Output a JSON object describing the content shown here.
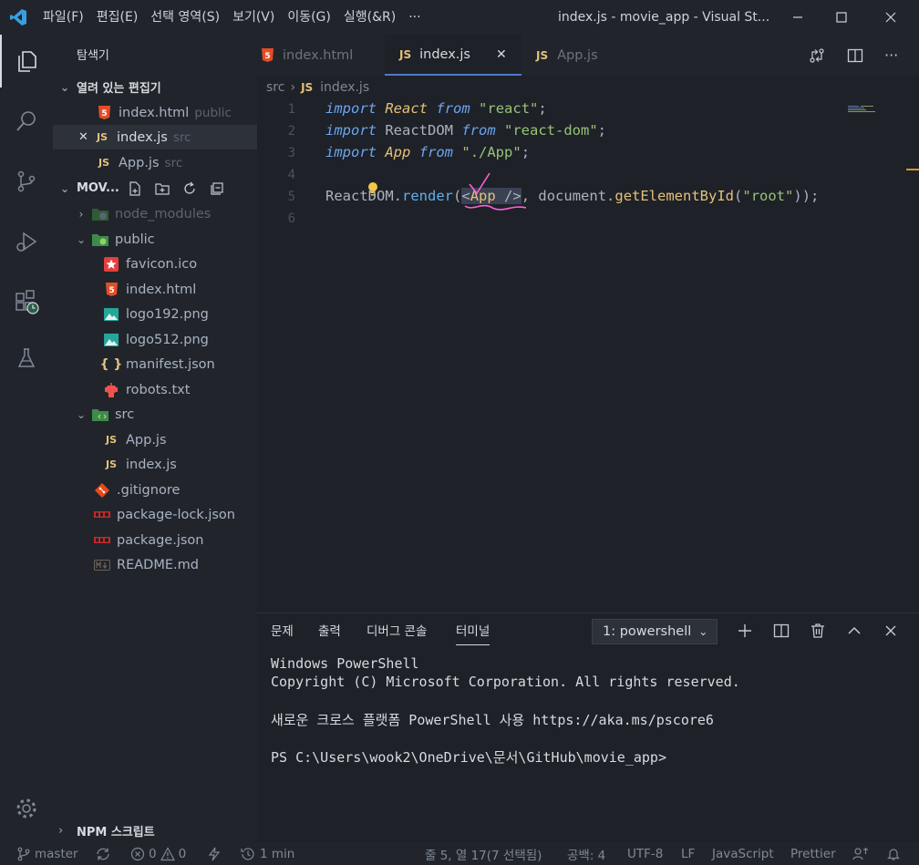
{
  "window": {
    "title": "index.js - movie_app - Visual St...",
    "menu": [
      "파일(F)",
      "편집(E)",
      "선택 영역(S)",
      "보기(V)",
      "이동(G)",
      "실행(&R)",
      "···"
    ]
  },
  "sidebar": {
    "title": "탐색기",
    "open_editors_header": "열려 있는 편집기",
    "open_editors": [
      {
        "name": "index.html",
        "dir": "public",
        "icon": "html5-icon"
      },
      {
        "name": "index.js",
        "dir": "src",
        "icon": "js-icon"
      },
      {
        "name": "App.js",
        "dir": "src",
        "icon": "js-icon"
      }
    ],
    "project_header": "MOV...",
    "tree": [
      {
        "name": "node_modules",
        "icon": "folder-node-icon"
      },
      {
        "name": "public",
        "icon": "folder-public-icon"
      },
      {
        "name": "favicon.ico",
        "icon": "star-icon"
      },
      {
        "name": "index.html",
        "icon": "html5-icon"
      },
      {
        "name": "logo192.png",
        "icon": "image-icon"
      },
      {
        "name": "logo512.png",
        "icon": "image-icon"
      },
      {
        "name": "manifest.json",
        "icon": "json-icon"
      },
      {
        "name": "robots.txt",
        "icon": "robot-icon"
      },
      {
        "name": "src",
        "icon": "folder-src-icon"
      },
      {
        "name": "App.js",
        "icon": "js-icon"
      },
      {
        "name": "index.js",
        "icon": "js-icon"
      },
      {
        "name": ".gitignore",
        "icon": "git-icon"
      },
      {
        "name": "package-lock.json",
        "icon": "npm-icon"
      },
      {
        "name": "package.json",
        "icon": "npm-icon"
      },
      {
        "name": "README.md",
        "icon": "markdown-icon"
      }
    ],
    "npm_header": "NPM 스크립트"
  },
  "tabs": [
    {
      "label": "index.html",
      "icon": "html5-icon"
    },
    {
      "label": "index.js",
      "icon": "js-icon"
    },
    {
      "label": "App.js",
      "icon": "js-icon"
    }
  ],
  "breadcrumb": {
    "folder": "src",
    "file": "index.js"
  },
  "editor": {
    "lines": [
      "1",
      "2",
      "3",
      "4",
      "5",
      "6"
    ]
  },
  "panel": {
    "tabs": [
      "문제",
      "출력",
      "디버그 콘솔",
      "터미널"
    ],
    "terminal_select": "1: powershell",
    "terminal_lines": [
      "Windows PowerShell",
      "Copyright (C) Microsoft Corporation. All rights reserved.",
      "새로운 크로스 플랫폼 PowerShell 사용 https://aka.ms/pscore6",
      "PS C:\\Users\\wook2\\OneDrive\\문서\\GitHub\\movie_app>"
    ]
  },
  "status": {
    "branch": "master",
    "errors": "0",
    "warnings": "0",
    "time": "1 min",
    "cursor": "줄 5, 열 17(7 선택됨)",
    "spaces": "공백: 4",
    "encoding": "UTF-8",
    "eol": "LF",
    "language": "JavaScript",
    "formatter": "Prettier"
  }
}
